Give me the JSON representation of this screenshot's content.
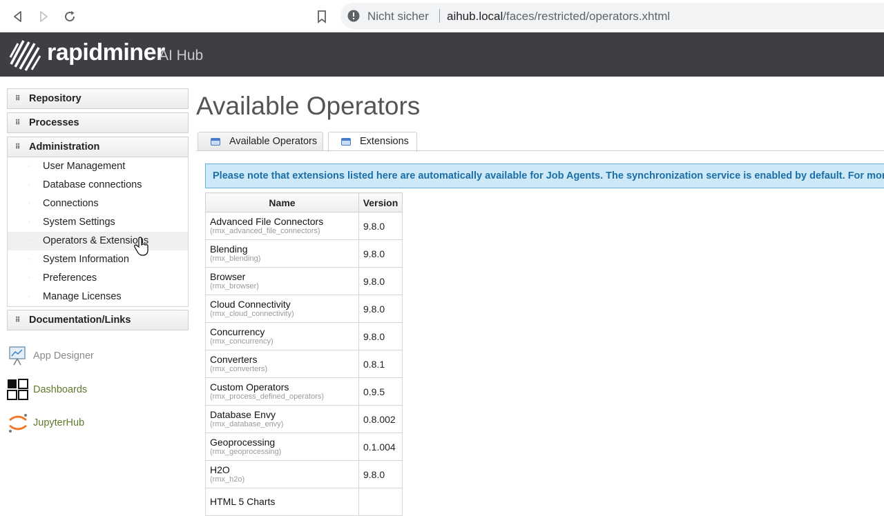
{
  "browser": {
    "security_label": "Nicht sicher",
    "url_host": "aihub.local",
    "url_path": "/faces/restricted/operators.xhtml"
  },
  "header": {
    "brand": "rapidminer",
    "product": "AI Hub"
  },
  "nav": {
    "groups": {
      "repository": "Repository",
      "processes": "Processes",
      "administration": "Administration",
      "documentation": "Documentation/Links"
    },
    "admin_items": [
      "User Management",
      "Database connections",
      "Connections",
      "System Settings",
      "Operators & Extensions",
      "System Information",
      "Preferences",
      "Manage Licenses"
    ],
    "active_item": "Operators & Extensions",
    "tools": [
      {
        "label": "App Designer",
        "color": "#8a8a8a"
      },
      {
        "label": "Dashboards",
        "color": "#5b7a2a"
      },
      {
        "label": "JupyterHub",
        "color": "#5b7a2a"
      }
    ]
  },
  "main": {
    "title": "Available Operators",
    "tabs": [
      "Available Operators",
      "Extensions"
    ],
    "active_tab": "Extensions",
    "notice": "Please note that extensions listed here are automatically available for Job Agents. The synchronization service is enabled by default. For more in",
    "table": {
      "headers": [
        "Name",
        "Version"
      ],
      "rows": [
        {
          "name": "Advanced File Connectors",
          "id": "(rmx_advanced_file_connectors)",
          "version": "9.8.0"
        },
        {
          "name": "Blending",
          "id": "(rmx_blending)",
          "version": "9.8.0"
        },
        {
          "name": "Browser",
          "id": "(rmx_browser)",
          "version": "9.8.0"
        },
        {
          "name": "Cloud Connectivity",
          "id": "(rmx_cloud_connectivity)",
          "version": "9.8.0"
        },
        {
          "name": "Concurrency",
          "id": "(rmx_concurrency)",
          "version": "9.8.0"
        },
        {
          "name": "Converters",
          "id": "(rmx_converters)",
          "version": "0.8.1"
        },
        {
          "name": "Custom Operators",
          "id": "(rmx_process_defined_operators)",
          "version": "0.9.5"
        },
        {
          "name": "Database Envy",
          "id": "(rmx_database_envy)",
          "version": "0.8.002"
        },
        {
          "name": "Geoprocessing",
          "id": "(rmx_geoprocessing)",
          "version": "0.1.004"
        },
        {
          "name": "H2O",
          "id": "(rmx_h2o)",
          "version": "9.8.0"
        },
        {
          "name": "HTML 5 Charts",
          "id": "",
          "version": ""
        }
      ]
    }
  },
  "colors": {
    "header_bg": "#3d3f44",
    "notice_bg": "#cde8f6",
    "notice_text": "#1b6ea8",
    "tool_link": "#5b7a2a"
  }
}
